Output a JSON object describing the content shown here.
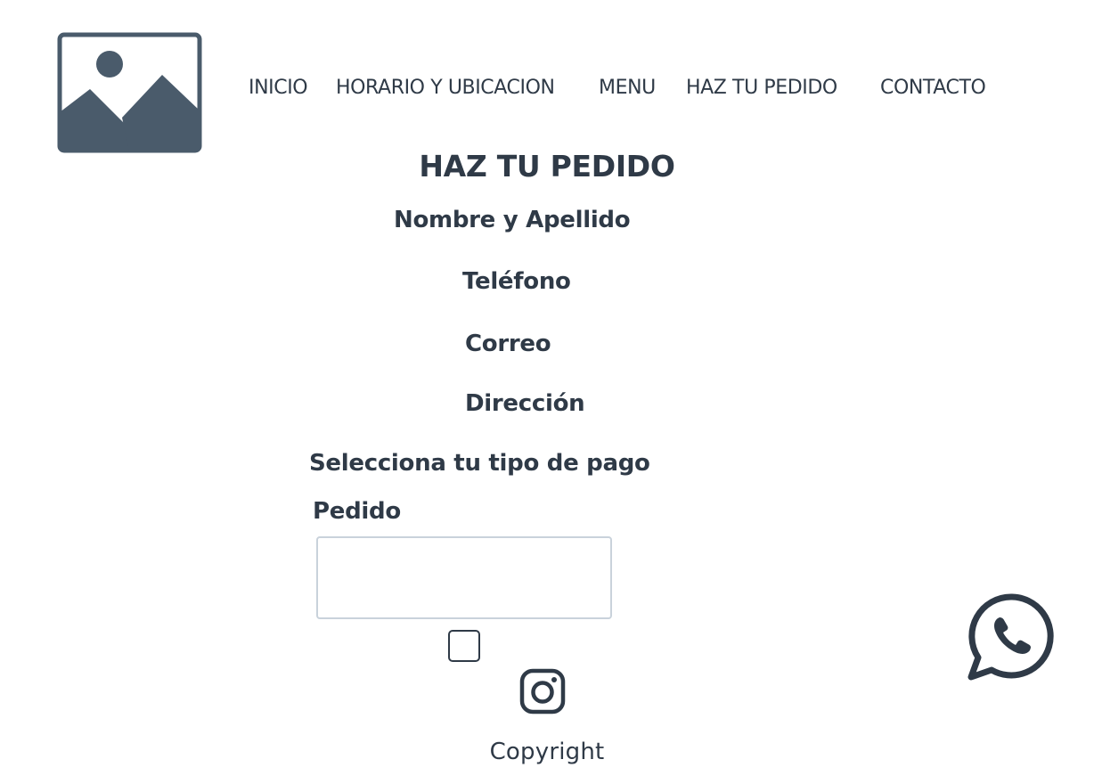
{
  "header": {
    "logo_icon": "image-placeholder-icon",
    "nav": [
      {
        "label": "INICIO"
      },
      {
        "label": "HORARIO Y UBICACION"
      },
      {
        "label": "MENU"
      },
      {
        "label": "HAZ TU PEDIDO"
      },
      {
        "label": "CONTACTO"
      }
    ]
  },
  "main": {
    "title": "HAZ TU PEDIDO",
    "form": {
      "name_label": "Nombre y Apellido",
      "phone_label": "Teléfono",
      "email_label": "Correo",
      "address_label": "Dirección",
      "payment_label": "Selecciona tu tipo de pago",
      "order_label": "Pedido",
      "order_value": "",
      "checkbox_checked": false
    }
  },
  "footer": {
    "social_icon": "instagram-icon",
    "copyright": "Copyright"
  },
  "floating": {
    "chat_icon": "whatsapp-icon"
  },
  "colors": {
    "text": "#2f3a47",
    "icon": "#4a5b6b",
    "input_border": "#c9d2db"
  }
}
